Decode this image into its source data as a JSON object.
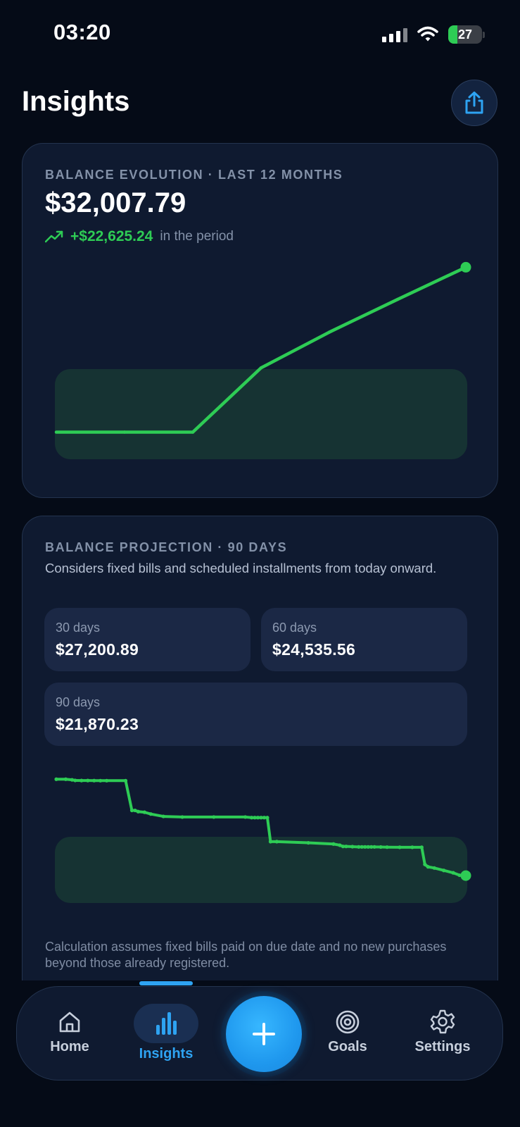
{
  "status_bar": {
    "time": "03:20",
    "battery": "27",
    "battery_level": 0.27,
    "battery_color": "#2ecc55",
    "icons": [
      "signal-icon",
      "wifi-icon",
      "battery-charging-icon"
    ]
  },
  "header": {
    "title": "Insights",
    "share_icon": "share-icon"
  },
  "evolution": {
    "label": "BALANCE EVOLUTION · LAST 12 MONTHS",
    "amount": "$32,007.79",
    "change": "+$22,625.24",
    "change_suffix": "in the period",
    "trend_icon": "trending-up-icon"
  },
  "projection": {
    "label": "BALANCE PROJECTION · 90 DAYS",
    "description": "Considers fixed bills and scheduled installments from today onward.",
    "boxes": [
      {
        "label": "30 days",
        "value": "$27,200.89"
      },
      {
        "label": "60 days",
        "value": "$24,535.56"
      },
      {
        "label": "90 days",
        "value": "$21,870.23"
      }
    ],
    "footnote": "Calculation assumes fixed bills paid on due date and no new purchases beyond those already registered."
  },
  "chart_data": [
    {
      "type": "line",
      "title": "BALANCE EVOLUTION · LAST 12 MONTHS",
      "x": [
        1,
        2,
        3,
        4,
        5,
        6,
        7
      ],
      "values": [
        9382.55,
        9382.55,
        9382.55,
        18200,
        23100,
        27600,
        32007.79
      ],
      "ylim": [
        4500,
        33500
      ],
      "grid": false,
      "line_color": "#2ecc55",
      "band_color": "#163333"
    },
    {
      "type": "line",
      "title": "BALANCE PROJECTION · 90 DAYS",
      "x": [
        0,
        3,
        5,
        6,
        8,
        10,
        12,
        14,
        16,
        22,
        24,
        25,
        26,
        28,
        30,
        34,
        40,
        50,
        60,
        62,
        63,
        64,
        65,
        66,
        67,
        68,
        70,
        80,
        88,
        90,
        91,
        92,
        94,
        96,
        97,
        98,
        99,
        100,
        101,
        103,
        105,
        109,
        113,
        116,
        117,
        118,
        120,
        123,
        126,
        128,
        130
      ],
      "values": [
        29900,
        29900,
        29850,
        29800,
        29790,
        29790,
        29785,
        29780,
        29780,
        29780,
        27300,
        27300,
        27200,
        27150,
        27000,
        26800,
        26750,
        26750,
        26750,
        26700,
        26700,
        26700,
        26700,
        26700,
        26700,
        24700,
        24700,
        24600,
        24500,
        24400,
        24300,
        24300,
        24280,
        24260,
        24260,
        24260,
        24260,
        24260,
        24260,
        24250,
        24240,
        24230,
        24230,
        24230,
        22800,
        22600,
        22500,
        22300,
        22100,
        21900,
        21870.23
      ],
      "ylim": [
        18000,
        31500
      ],
      "grid": false,
      "line_color": "#2ecc55",
      "band_color": "#163333"
    }
  ],
  "nav": {
    "items": [
      {
        "label": "Home",
        "icon": "home-icon"
      },
      {
        "label": "Insights",
        "icon": "bar-chart-icon",
        "active": true
      },
      {
        "label": "Goals",
        "icon": "target-icon"
      },
      {
        "label": "Settings",
        "icon": "gear-icon"
      }
    ],
    "add_icon": "plus-icon",
    "accent": "#2ea3f2"
  }
}
